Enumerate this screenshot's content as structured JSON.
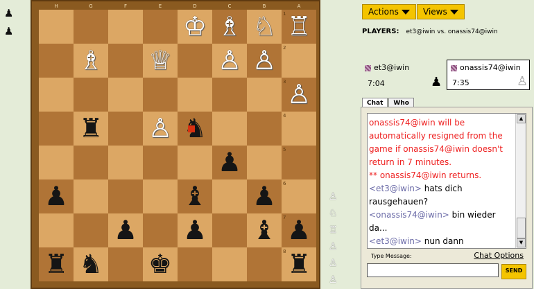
{
  "captured_left": [
    "♟",
    "♟"
  ],
  "files": [
    "H",
    "G",
    "F",
    "E",
    "D",
    "C",
    "B",
    "A"
  ],
  "ranks": [
    "1",
    "2",
    "3",
    "4",
    "5",
    "6",
    "7",
    "8"
  ],
  "board": [
    [
      "",
      "",
      "",
      "",
      "♔",
      "♗",
      "♘",
      "♖"
    ],
    [
      "",
      "♗",
      "",
      "♕",
      "",
      "♙",
      "♙",
      ""
    ],
    [
      "",
      "",
      "",
      "",
      "",
      "",
      "",
      "♙"
    ],
    [
      "",
      "♜",
      "",
      "♙",
      "♞",
      "",
      "",
      ""
    ],
    [
      "",
      "",
      "",
      "",
      "",
      "♟",
      "",
      ""
    ],
    [
      "♟",
      "",
      "",
      "",
      "♝",
      "",
      "♟",
      ""
    ],
    [
      "",
      "",
      "♟",
      "",
      "♟",
      "",
      "♝",
      "♟"
    ],
    [
      "♜",
      "♞",
      "",
      "♚",
      "",
      "",
      "",
      "♜"
    ]
  ],
  "board_colors": [
    [
      "",
      "",
      "",
      "",
      "w",
      "w",
      "w",
      "w"
    ],
    [
      "",
      "w",
      "",
      "w",
      "",
      "w",
      "w",
      ""
    ],
    [
      "",
      "",
      "",
      "",
      "",
      "",
      "",
      "w"
    ],
    [
      "",
      "b",
      "",
      "w",
      "b",
      "",
      "",
      ""
    ],
    [
      "",
      "",
      "",
      "",
      "",
      "b",
      "",
      ""
    ],
    [
      "b",
      "",
      "",
      "",
      "b",
      "",
      "b",
      ""
    ],
    [
      "",
      "",
      "b",
      "",
      "b",
      "",
      "b",
      "b"
    ],
    [
      "b",
      "b",
      "",
      "b",
      "",
      "",
      "",
      "b"
    ]
  ],
  "captured_right": [
    "♙",
    "♘",
    "♖",
    "♙",
    "♙",
    "♙"
  ],
  "toolbar": {
    "actions_label": "Actions",
    "views_label": "Views"
  },
  "players": {
    "label": "PLAYERS:",
    "summary": "et3@iwin vs. onassis74@iwin"
  },
  "player1": {
    "name": "et3@iwin",
    "time": "7:04",
    "piece": "♟"
  },
  "player2": {
    "name": "onassis74@iwin",
    "time": "7:35",
    "piece": "♙"
  },
  "tabs": {
    "chat": "Chat",
    "who": "Who"
  },
  "chat": {
    "messages": [
      {
        "type": "system",
        "text": "onassis74@iwin will be automatically resigned from the game if onassis74@iwin doesn't return in 7 minutes."
      },
      {
        "type": "system",
        "text": "** onassis74@iwin returns."
      },
      {
        "type": "user",
        "name": "<et3@iwin>",
        "text": " hats dich rausgehauen?"
      },
      {
        "type": "user",
        "name": "<onassis74@iwin>",
        "text": " bin wieder da..."
      },
      {
        "type": "user",
        "name": "<et3@iwin>",
        "text": " nun dann"
      }
    ],
    "type_label": "Type Message:",
    "options_label": "Chat Options",
    "input_value": "",
    "send_label": "SEND"
  }
}
